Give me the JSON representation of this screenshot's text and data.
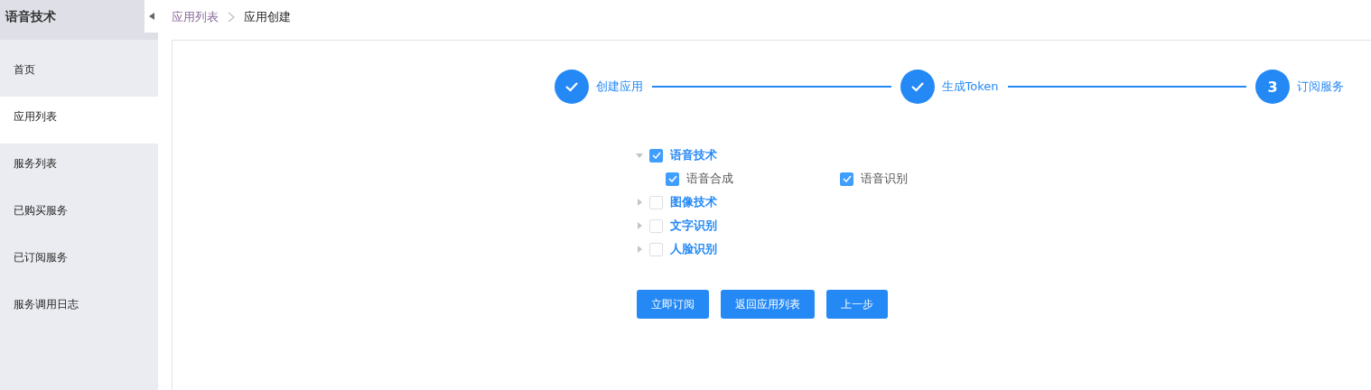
{
  "sidebar": {
    "title": "语音技术",
    "items": [
      {
        "label": "首页",
        "selected": false
      },
      {
        "label": "应用列表",
        "selected": true
      },
      {
        "label": "服务列表",
        "selected": false
      },
      {
        "label": "已购买服务",
        "selected": false
      },
      {
        "label": "已订阅服务",
        "selected": false
      },
      {
        "label": "服务调用日志",
        "selected": false
      }
    ]
  },
  "breadcrumb": [
    {
      "label": "应用列表",
      "link": true
    },
    {
      "label": "应用创建",
      "link": false
    }
  ],
  "steps": [
    {
      "label": "创建应用",
      "done": true
    },
    {
      "label": "生成Token",
      "done": true
    },
    {
      "label": "订阅服务",
      "done": false,
      "number": "3"
    }
  ],
  "tree": [
    {
      "label": "语音技术",
      "checked": true,
      "expanded": true,
      "children": [
        {
          "label": "语音合成",
          "checked": true
        },
        {
          "label": "语音识别",
          "checked": true
        }
      ]
    },
    {
      "label": "图像技术",
      "checked": false,
      "expanded": false
    },
    {
      "label": "文字识别",
      "checked": false,
      "expanded": false
    },
    {
      "label": "人脸识别",
      "checked": false,
      "expanded": false
    }
  ],
  "buttons": [
    "立即订阅",
    "返回应用列表",
    "上一步"
  ]
}
